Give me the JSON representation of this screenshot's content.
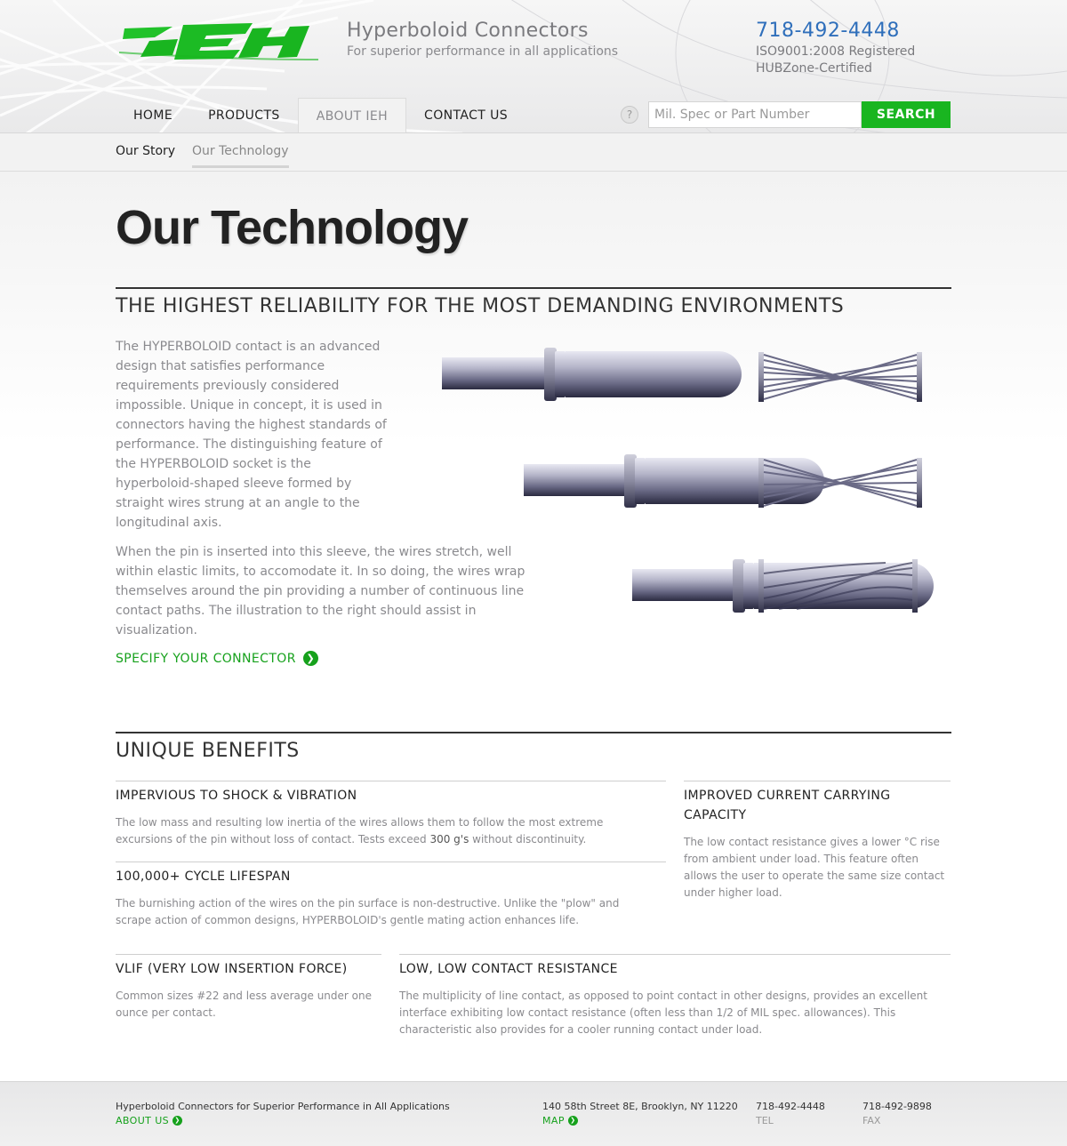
{
  "brand": {
    "logo_text": "IEH",
    "accent_color": "#19b520",
    "link_color": "#2f6fbb"
  },
  "header": {
    "title": "Hyperboloid Connectors",
    "subtitle": "For superior performance in all applications",
    "phone": "718-492-4448",
    "cert_1": "ISO9001:2008 Registered",
    "cert_2": "HUBZone-Certified"
  },
  "nav": {
    "items": [
      {
        "label": "HOME"
      },
      {
        "label": "PRODUCTS"
      },
      {
        "label": "ABOUT IEH",
        "active": true
      },
      {
        "label": "CONTACT US"
      }
    ]
  },
  "search": {
    "help_icon": "question-circle-icon",
    "help_glyph": "?",
    "placeholder": "Mil. Spec or Part Number",
    "value": "",
    "button_label": "SEARCH"
  },
  "subnav": {
    "items": [
      {
        "label": "Our Story"
      },
      {
        "label": "Our Technology",
        "active": true
      }
    ]
  },
  "main": {
    "page_title": "Our Technology",
    "section1_heading": "THE HIGHEST RELIABILITY FOR THE MOST DEMANDING ENVIRONMENTS",
    "para1": "The HYPERBOLOID contact is an advanced design that satisfies performance requirements previously considered impossible. Unique in concept, it is used in connectors having the highest standards of performance. The distinguishing feature of the HYPERBOLOID socket is the hyperboloid-shaped sleeve formed by straight wires strung at an angle to the longitudinal axis.",
    "para2": "When the pin is inserted into this sleeve, the wires stretch, well within elastic limits, to accomodate it. In so doing, the wires wrap themselves around the pin providing a number of continuous line contact paths. The illustration to the right should assist in visualization.",
    "cta_label": "SPECIFY YOUR CONNECTOR",
    "cta_icon": "chevron-right-circle-icon",
    "section2_heading": "UNIQUE BENEFITS"
  },
  "benefits": [
    {
      "title": "IMPERVIOUS TO SHOCK & VIBRATION",
      "text_before": "The low mass and resulting low inertia of the wires allows them to follow the most extreme excursions of the pin without loss of contact. Tests exceed ",
      "text_emph": "300 g's",
      "text_after": " without discontinuity."
    },
    {
      "title": "IMPROVED CURRENT CARRYING CAPACITY",
      "text": "The low contact resistance gives a lower °C rise from ambient under load. This feature often allows the user to operate the same size contact under higher load."
    },
    {
      "title": "100,000+ CYCLE LIFESPAN",
      "text": "The burnishing action of the wires on the pin surface is non-destructive. Unlike the \"plow\" and scrape action of common designs, HYPERBOLOID's gentle mating action enhances life."
    },
    {
      "title": "VLIF (VERY LOW INSERTION FORCE)",
      "text": "Common sizes #22 and less average under one ounce per contact."
    },
    {
      "title": "LOW, LOW CONTACT RESISTANCE",
      "text": "The multiplicity of line contact, as opposed to point contact in other designs, provides an excellent interface exhibiting low contact resistance (often less than 1/2 of MIL spec. allowances). This characteristic also provides for a cooler running contact under load."
    }
  ],
  "footer": {
    "tagline": "Hyperboloid Connectors for Superior Performance in All Applications",
    "about_link": "ABOUT US",
    "address": "140 58th Street 8E, Brooklyn, NY 11220",
    "map_link": "MAP",
    "tel_number": "718-492-4448",
    "tel_label": "TEL",
    "fax_number": "718-492-9898",
    "fax_label": "FAX"
  }
}
